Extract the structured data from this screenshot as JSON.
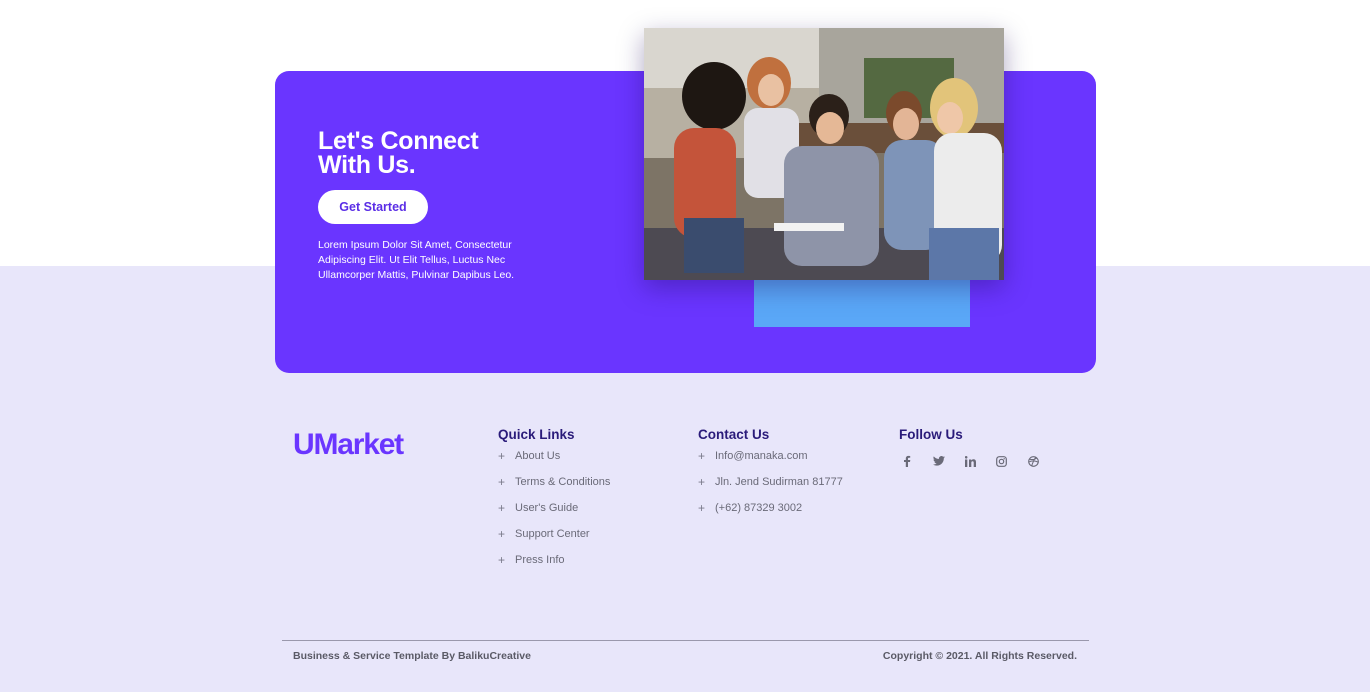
{
  "cta": {
    "title_line1": "Let's Connect",
    "title_line2": "With Us.",
    "button_label": "Get Started",
    "description": "Lorem Ipsum Dolor Sit Amet, Consectetur Adipiscing Elit. Ut Elit Tellus, Luctus Nec Ullamcorper Mattis, Pulvinar Dapibus Leo."
  },
  "footer": {
    "logo": "UMarket",
    "quick_links": {
      "title": "Quick Links",
      "items": [
        "About Us",
        "Terms & Conditions",
        "User's Guide",
        "Support Center",
        "Press Info"
      ]
    },
    "contact": {
      "title": "Contact Us",
      "items": [
        "Info@manaka.com",
        "Jln. Jend Sudirman 81777",
        "(+62) 87329 3002"
      ]
    },
    "follow": {
      "title": "Follow Us",
      "icons": [
        "facebook-icon",
        "twitter-icon",
        "linkedin-icon",
        "instagram-icon",
        "dribbble-icon"
      ]
    },
    "bottom_left": "Business & Service Template By BalikuCreative",
    "bottom_right": "Copyright © 2021. All Rights Reserved."
  },
  "colors": {
    "brand": "#6a35ff",
    "accent": "#5aa7f7",
    "footer_bg": "#e8e6fa",
    "heading": "#2a1b7a"
  }
}
